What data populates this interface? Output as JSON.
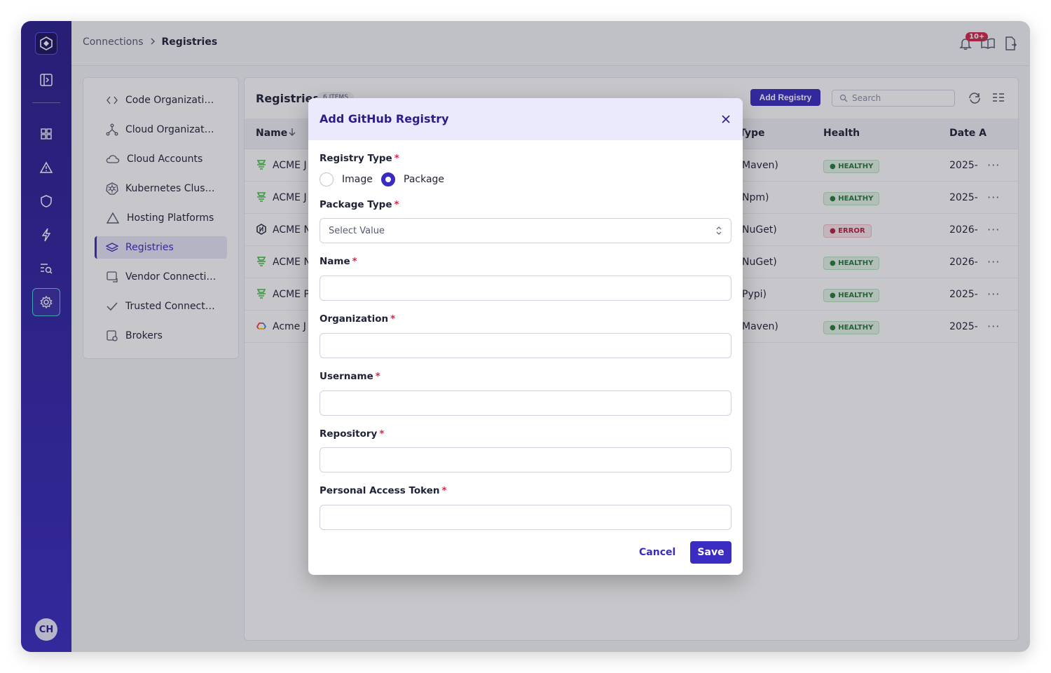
{
  "breadcrumb": {
    "parent": "Connections",
    "current": "Registries"
  },
  "topbar": {
    "notifications_badge": "10+"
  },
  "user": {
    "initials": "CH"
  },
  "menu": {
    "items": [
      {
        "label": "Code Organizations",
        "icon": "code-icon"
      },
      {
        "label": "Cloud Organizations",
        "icon": "org-tree-icon"
      },
      {
        "label": "Cloud Accounts",
        "icon": "cloud-icon"
      },
      {
        "label": "Kubernetes Clusters",
        "icon": "kubernetes-icon"
      },
      {
        "label": "Hosting Platforms",
        "icon": "triangle-icon"
      },
      {
        "label": "Registries",
        "icon": "layers-icon",
        "active": true
      },
      {
        "label": "Vendor Connections",
        "icon": "vendor-icon"
      },
      {
        "label": "Trusted Connectio...",
        "icon": "check-icon"
      },
      {
        "label": "Brokers",
        "icon": "broker-icon"
      }
    ]
  },
  "panel": {
    "title": "Registries",
    "count_badge": "6 ITEMS",
    "add_button": "Add Registry",
    "search_placeholder": "Search",
    "columns": {
      "name": "Name",
      "type": "Type",
      "health": "Health",
      "date": "Date A"
    },
    "rows": [
      {
        "name": "ACME J",
        "type": "Maven)",
        "health": "HEALTHY",
        "status": "ok",
        "date": "2025-",
        "icon": "jfrog-icon"
      },
      {
        "name": "ACME J",
        "type": "Npm)",
        "health": "HEALTHY",
        "status": "ok",
        "date": "2025-",
        "icon": "jfrog-icon"
      },
      {
        "name": "ACME N",
        "type": "NuGet)",
        "health": "ERROR",
        "status": "err",
        "date": "2026-",
        "icon": "nexus-icon"
      },
      {
        "name": "ACME N",
        "type": "NuGet)",
        "health": "HEALTHY",
        "status": "ok",
        "date": "2026-",
        "icon": "jfrog-icon"
      },
      {
        "name": "ACME P",
        "type": "Pypi)",
        "health": "HEALTHY",
        "status": "ok",
        "date": "2025-",
        "icon": "jfrog-icon"
      },
      {
        "name": "Acme J",
        "type": "Maven)",
        "health": "HEALTHY",
        "status": "ok",
        "date": "2025-",
        "icon": "gcp-icon"
      }
    ]
  },
  "modal": {
    "title": "Add GitHub Registry",
    "registry_type_label": "Registry Type",
    "radio_image": "Image",
    "radio_package": "Package",
    "selected_registry_type": "Package",
    "package_type_label": "Package Type",
    "package_type_placeholder": "Select Value",
    "name_label": "Name",
    "organization_label": "Organization",
    "username_label": "Username",
    "repository_label": "Repository",
    "token_label": "Personal Access Token",
    "required_mark": "*",
    "cancel_label": "Cancel",
    "save_label": "Save"
  },
  "colors": {
    "brand": "#3a2cc0",
    "healthy": "#2a7a3c",
    "error": "#b3223f",
    "required": "#d6264a"
  }
}
